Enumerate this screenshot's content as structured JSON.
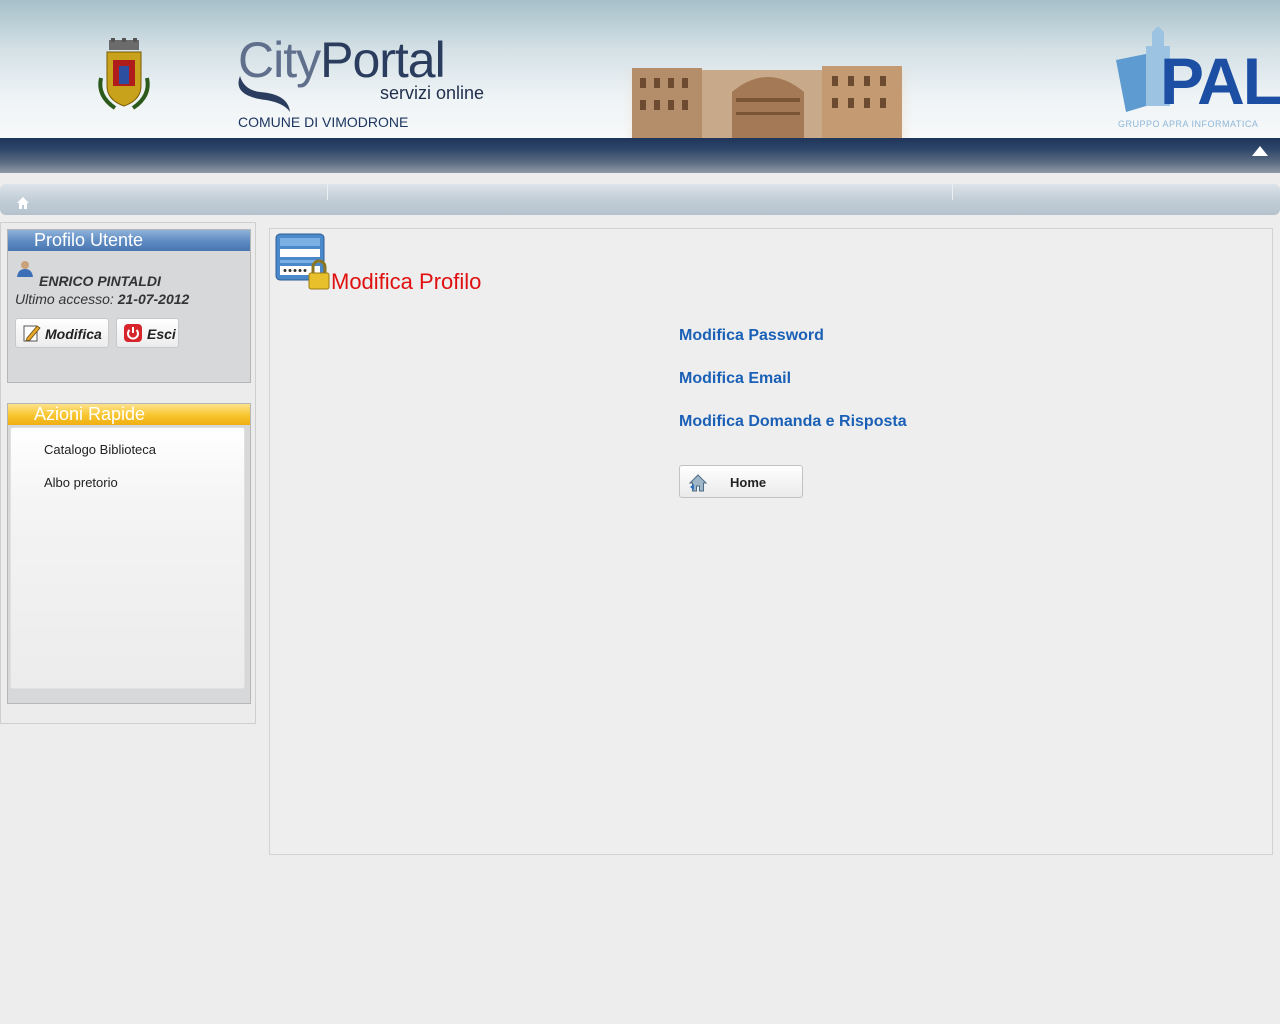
{
  "header": {
    "logo_city": "City",
    "logo_portal": "Portal",
    "logo_sub": "servizi online",
    "comune": "COMUNE DI VIMODRONE",
    "partner_logo": "PAL",
    "partner_sub": "GRUPPO APRA INFORMATICA"
  },
  "sidebar": {
    "profile_panel": {
      "title": "Profilo Utente",
      "user_name": "ENRICO PINTALDI",
      "last_access_label": "Ultimo accesso:",
      "last_access_date": "21-07-2012",
      "modify_button": "Modifica",
      "exit_button": "Esci"
    },
    "quick_panel": {
      "title": "Azioni Rapide",
      "items": [
        {
          "label": "Catalogo Biblioteca"
        },
        {
          "label": "Albo pretorio"
        }
      ]
    }
  },
  "main": {
    "title": "Modifica Profilo",
    "links": [
      {
        "label": "Modifica Password"
      },
      {
        "label": "Modifica Email"
      },
      {
        "label": "Modifica Domanda e Risposta"
      }
    ],
    "home_button": "Home"
  },
  "colors": {
    "title_red": "#e01010",
    "link_blue": "#1a60b6",
    "nav_dark": "#1e3559",
    "panel_blue": "#5d8ac2",
    "panel_orange": "#f8c52d"
  },
  "icons": {
    "crest": "municipal-crest-icon",
    "collapse": "triangle-up-icon",
    "breadcrumb_home": "home-icon",
    "user": "user-icon",
    "modify": "edit-icon",
    "exit": "power-icon",
    "profile": "login-lock-icon",
    "home": "home-icon"
  }
}
